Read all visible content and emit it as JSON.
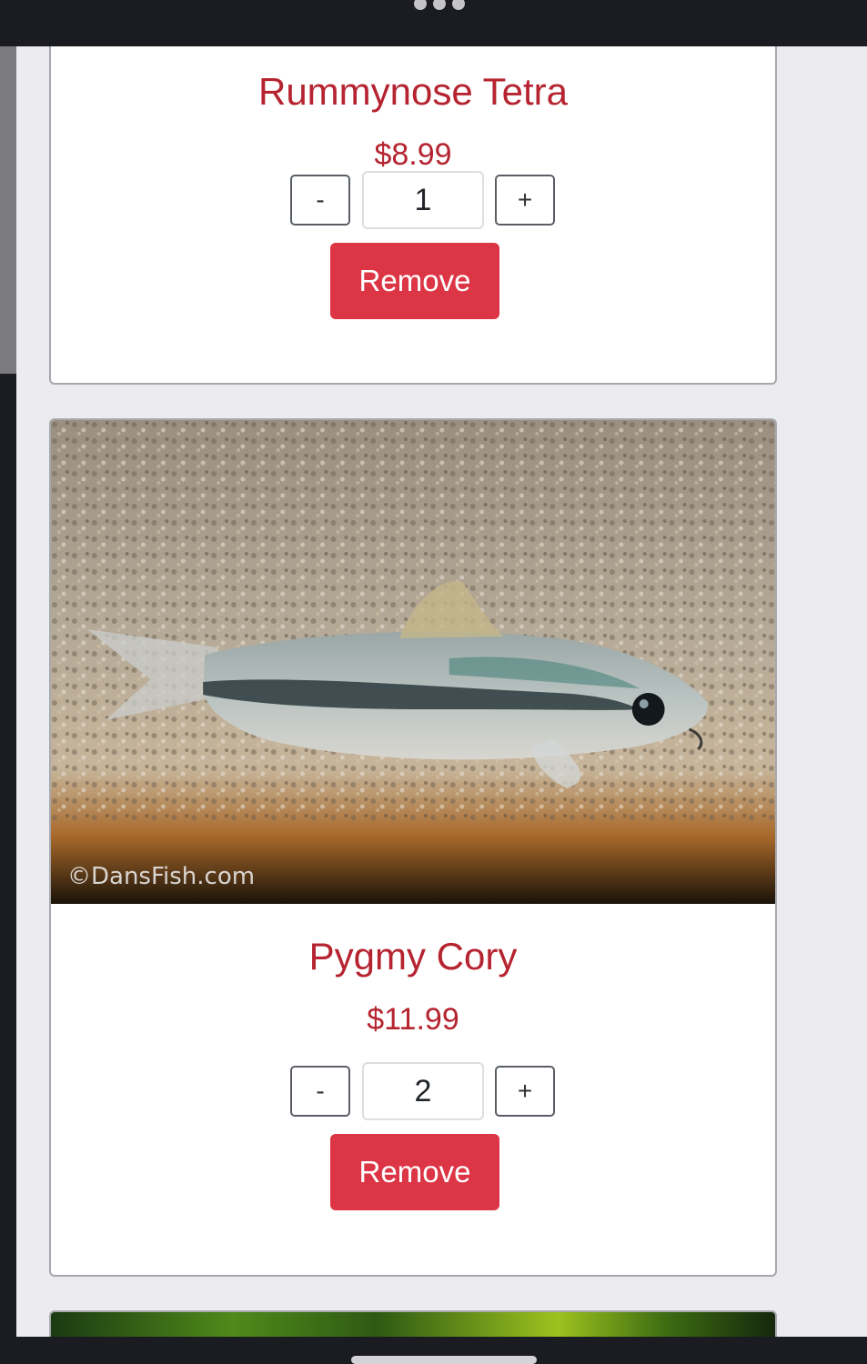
{
  "cart": {
    "items": [
      {
        "name": "Rummynose Tetra",
        "price": "$8.99",
        "quantity": "1",
        "minus_label": "-",
        "plus_label": "+",
        "remove_label": "Remove"
      },
      {
        "name": "Pygmy Cory",
        "price": "$11.99",
        "quantity": "2",
        "minus_label": "-",
        "plus_label": "+",
        "remove_label": "Remove",
        "image_watermark": "©DansFish.com"
      }
    ]
  },
  "colors": {
    "accent_text": "#b52430",
    "remove_button": "#dc3545",
    "page_bg": "#ececee"
  },
  "icons": {
    "minus": "minus-icon",
    "plus": "plus-icon"
  }
}
